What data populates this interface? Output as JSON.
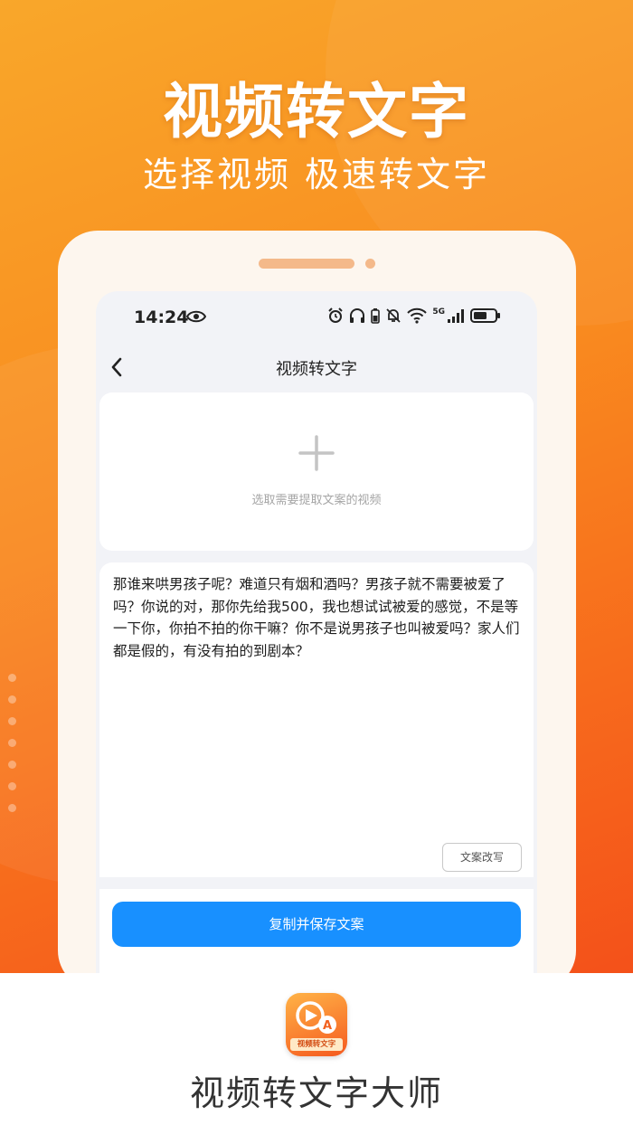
{
  "hero": {
    "title": "视频转文字",
    "subtitle": "选择视频 极速转文字"
  },
  "statusbar": {
    "time": "14:24",
    "network_label": "5G",
    "icons": [
      "eye-icon",
      "alarm-icon",
      "headphones-icon",
      "battery-small-icon",
      "mute-bell-icon",
      "wifi-icon",
      "signal-icon",
      "battery-icon"
    ]
  },
  "navbar": {
    "title": "视频转文字",
    "back_icon": "chevron-left-icon"
  },
  "picker": {
    "icon": "plus-icon",
    "hint": "选取需要提取文案的视频"
  },
  "transcript": {
    "text": "那谁来哄男孩子呢？难道只有烟和酒吗？男孩子就不需要被爱了吗？你说的对，那你先给我500，我也想试试被爱的感觉，不是等一下你，你拍不拍的你干嘛？你不是说男孩子也叫被爱吗？家人们都是假的，有没有拍的到剧本？"
  },
  "buttons": {
    "rewrite": "文案改写",
    "copy_save": "复制并保存文案"
  },
  "app": {
    "icon_label": "视频转文字",
    "name": "视频转文字大师"
  },
  "colors": {
    "hero_gradient_start": "#f9a72a",
    "hero_gradient_end": "#f4511a",
    "primary_button": "#1890ff",
    "phone_frame": "#fdf6ee"
  }
}
